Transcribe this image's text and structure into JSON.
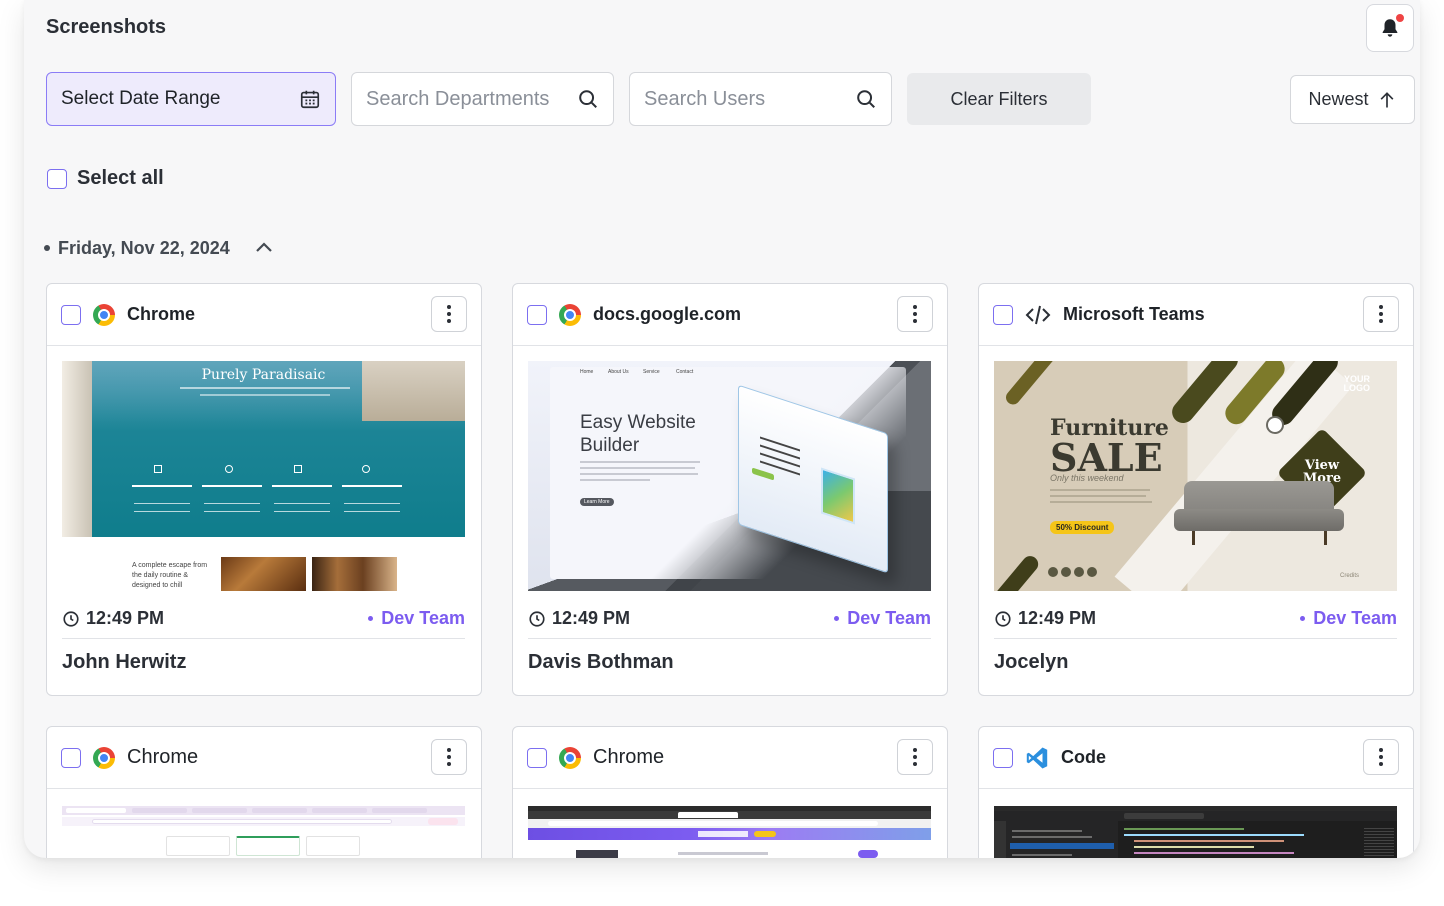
{
  "header": {
    "title": "Screenshots"
  },
  "filters": {
    "date_range": "Select Date Range",
    "search_departments_placeholder": "Search Departments",
    "search_users_placeholder": "Search Users",
    "clear": "Clear Filters",
    "sort": "Newest"
  },
  "select_all": "Select all",
  "group": {
    "date": "Friday, Nov 22, 2024"
  },
  "cards": [
    {
      "app": "Chrome",
      "time": "12:49 PM",
      "team": "Dev Team",
      "user": "John Herwitz",
      "thumb": {
        "headline": "Purely Paradisaic",
        "caption": "A complete escape from the daily routine & designed to chill"
      }
    },
    {
      "app": "docs.google.com",
      "time": "12:49 PM",
      "team": "Dev Team",
      "user": "Davis Bothman",
      "thumb": {
        "headline": "Easy Website Builder",
        "nav": [
          "Home",
          "About Us",
          "Service",
          "Contact"
        ],
        "button": "Learn More"
      }
    },
    {
      "app": "Microsoft Teams",
      "time": "12:49 PM",
      "team": "Dev Team",
      "user": "Jocelyn",
      "thumb": {
        "title1": "Furniture",
        "title2": "SALE",
        "subtitle": "Only this weekend",
        "discount": "50% Discount",
        "cta": "View More",
        "logo": "YOUR LOGO",
        "credits": "Credits"
      }
    },
    {
      "app": "Chrome"
    },
    {
      "app": "Chrome"
    },
    {
      "app": "Code"
    }
  ],
  "colors": {
    "accent": "#7c5cf0",
    "chip_bg": "#eeebfc",
    "notification_dot": "#ef4444"
  }
}
